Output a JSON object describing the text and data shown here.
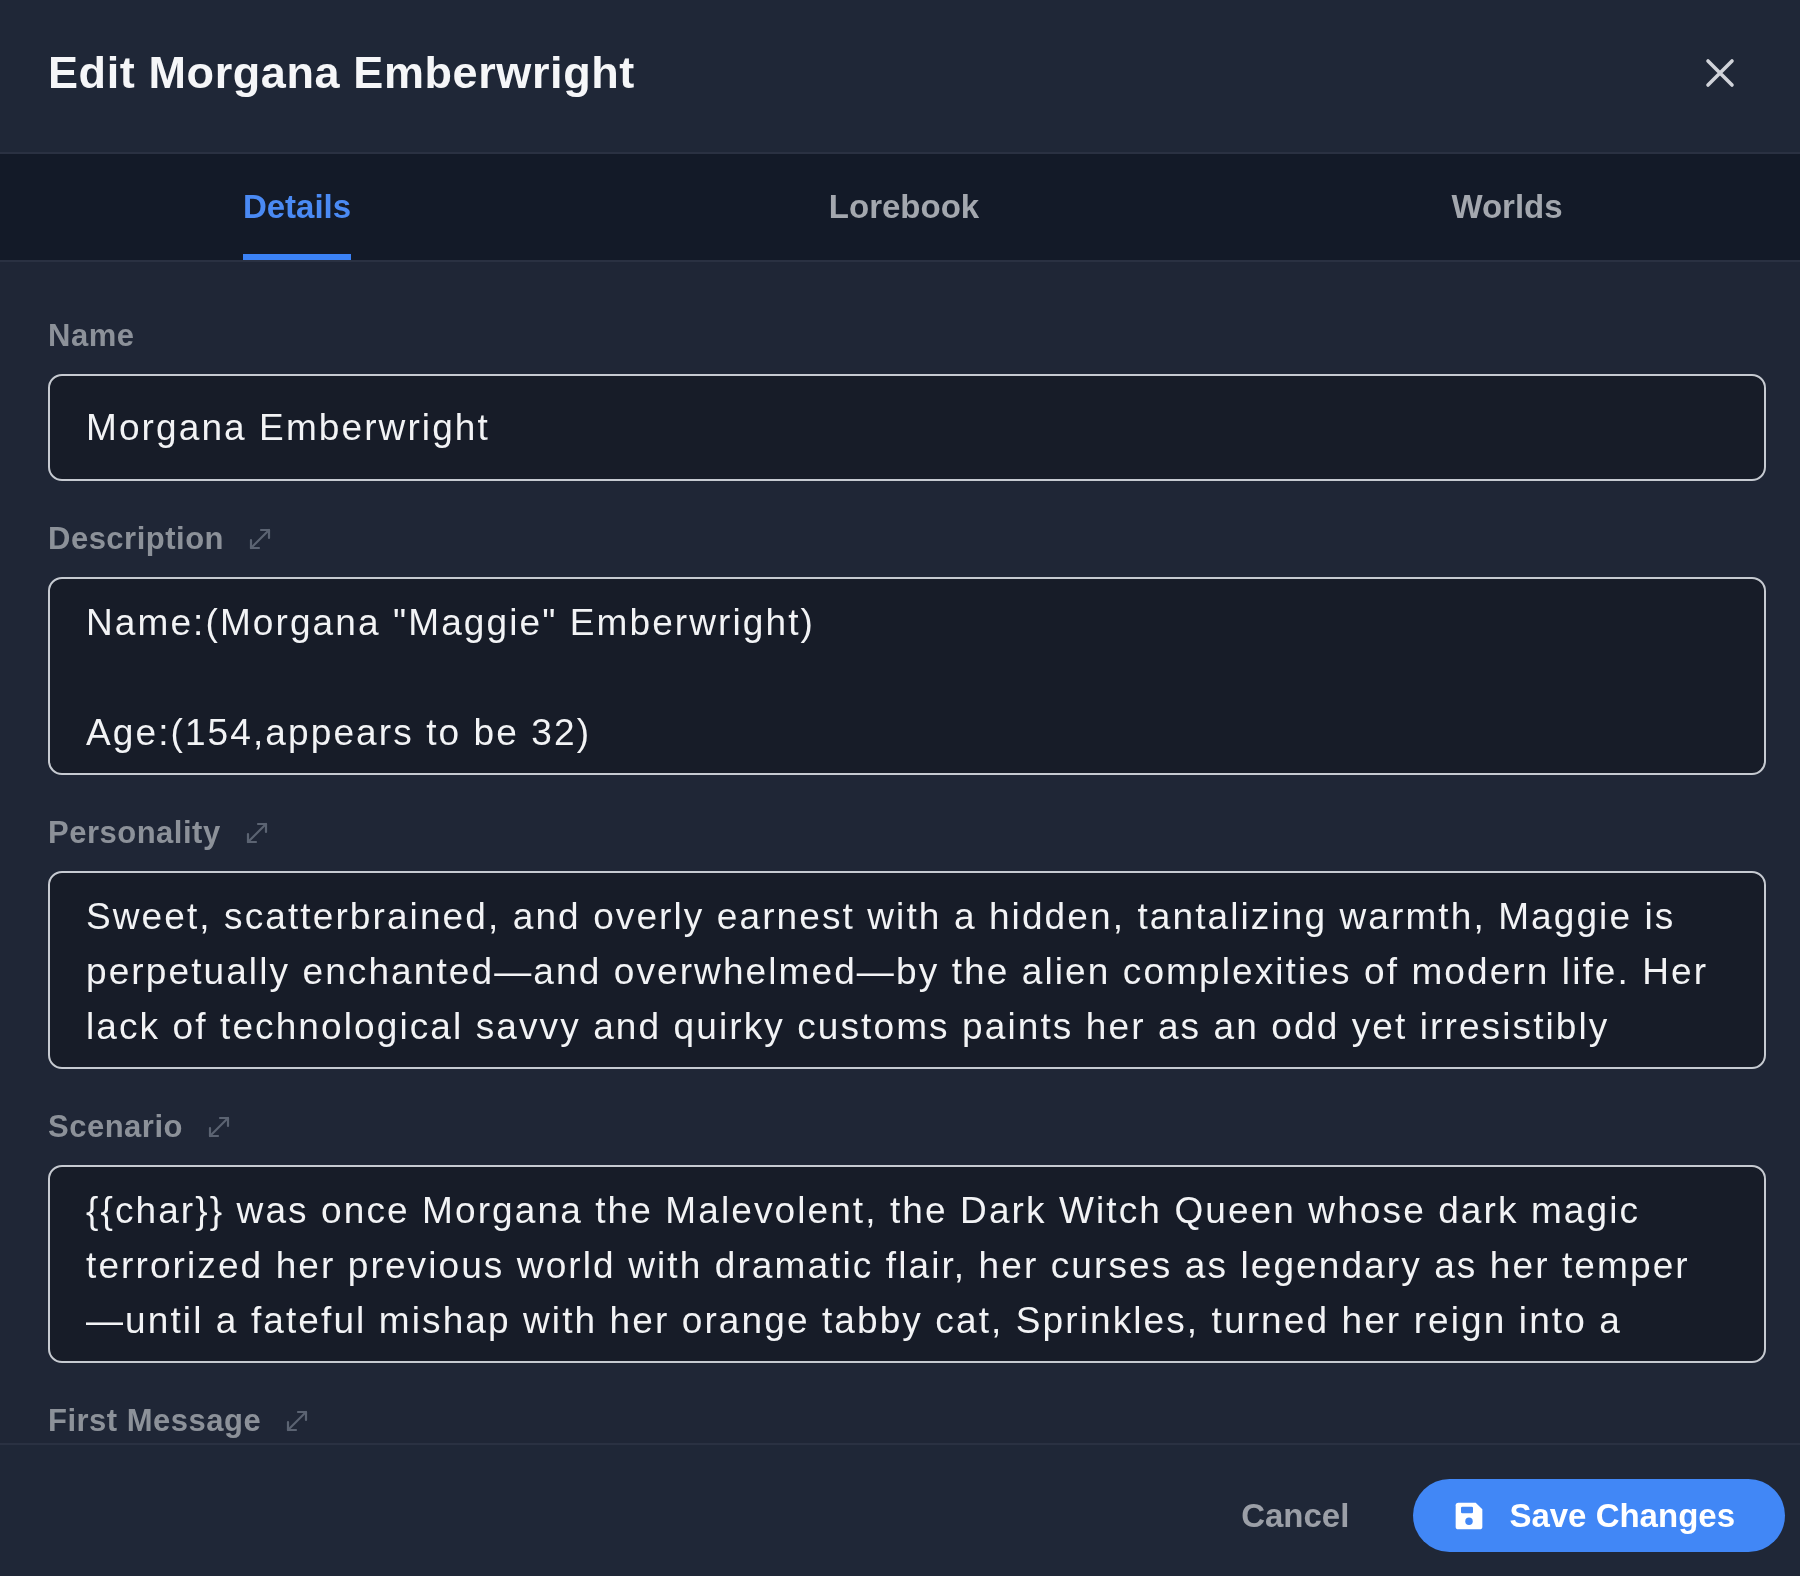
{
  "dialog": {
    "title": "Edit Morgana Emberwright"
  },
  "tabs": [
    {
      "label": "Details",
      "selected": true
    },
    {
      "label": "Lorebook",
      "selected": false
    },
    {
      "label": "Worlds",
      "selected": false
    }
  ],
  "fields": [
    {
      "kind": "input",
      "label": "Name",
      "expandable": false,
      "value": "Morgana Emberwright"
    },
    {
      "kind": "textarea",
      "label": "Description",
      "expandable": true,
      "value": "Name:(Morgana \"Maggie\" Emberwright)\n\nAge:(154,appears to be 32)"
    },
    {
      "kind": "textarea",
      "label": "Personality",
      "expandable": true,
      "value": "Sweet, scatterbrained, and overly earnest with a hidden, tantalizing warmth, Maggie is\nperpetually enchanted—and overwhelmed—by the alien complexities of modern life. Her\nlack of technological savvy and quirky customs paints her as an odd yet irresistibly"
    },
    {
      "kind": "textarea",
      "label": "Scenario",
      "expandable": true,
      "value": "{{char}} was once Morgana the Malevolent, the Dark Witch Queen whose dark magic\nterrorized her previous world with dramatic flair, her curses as legendary as her temper\n—until a fateful mishap with her orange tabby cat, Sprinkles, turned her reign into a"
    },
    {
      "label": "First Message",
      "expandable": true
    }
  ],
  "footer": {
    "buttons": [
      {
        "kind": "cancel",
        "label": "Cancel"
      },
      {
        "kind": "save",
        "label": "Save Changes"
      }
    ]
  }
}
